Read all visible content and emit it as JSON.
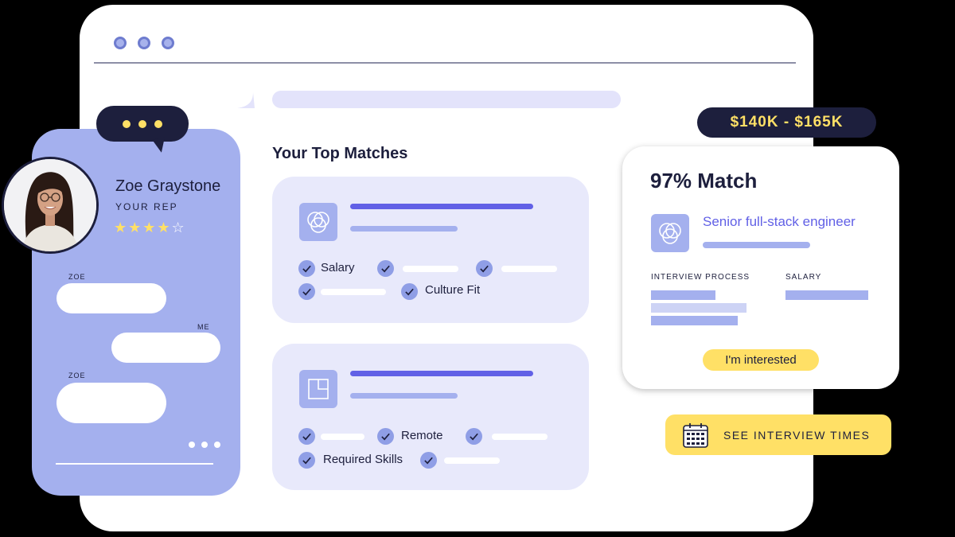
{
  "colors": {
    "background": "#000000",
    "window": "#ffffff",
    "lavender": "#a4b0ee",
    "light_lavender": "#e8e9fb",
    "accent_purple": "#6160e6",
    "navy": "#1d1f3d",
    "yellow": "#ffe066"
  },
  "browser": {
    "dots": [
      "dot",
      "dot",
      "dot"
    ]
  },
  "matches": {
    "title": "Your Top Matches",
    "cards": [
      {
        "icon": "venn-circles-icon",
        "checks": [
          "Salary",
          "Culture Fit"
        ]
      },
      {
        "icon": "layout-square-icon",
        "checks": [
          "Remote",
          "Required Skills"
        ]
      }
    ]
  },
  "rep": {
    "name": "Zoe Graystone",
    "role": "YOUR REP",
    "rating": 4,
    "rating_max": 5,
    "stars_filled": "★★★★",
    "stars_empty": "☆"
  },
  "chat": {
    "messages": [
      {
        "sender": "ZOE"
      },
      {
        "sender": "ME"
      },
      {
        "sender": "ZOE"
      }
    ]
  },
  "detail": {
    "salary_range": "$140K - $165K",
    "match_percent": "97% Match",
    "job_title": "Senior full-stack engineer",
    "interview_label": "INTERVIEW PROCESS",
    "salary_label": "SALARY",
    "interested_button": "I'm interested"
  },
  "cta": {
    "icon": "calendar-icon",
    "label": "SEE INTERVIEW TIMES"
  }
}
